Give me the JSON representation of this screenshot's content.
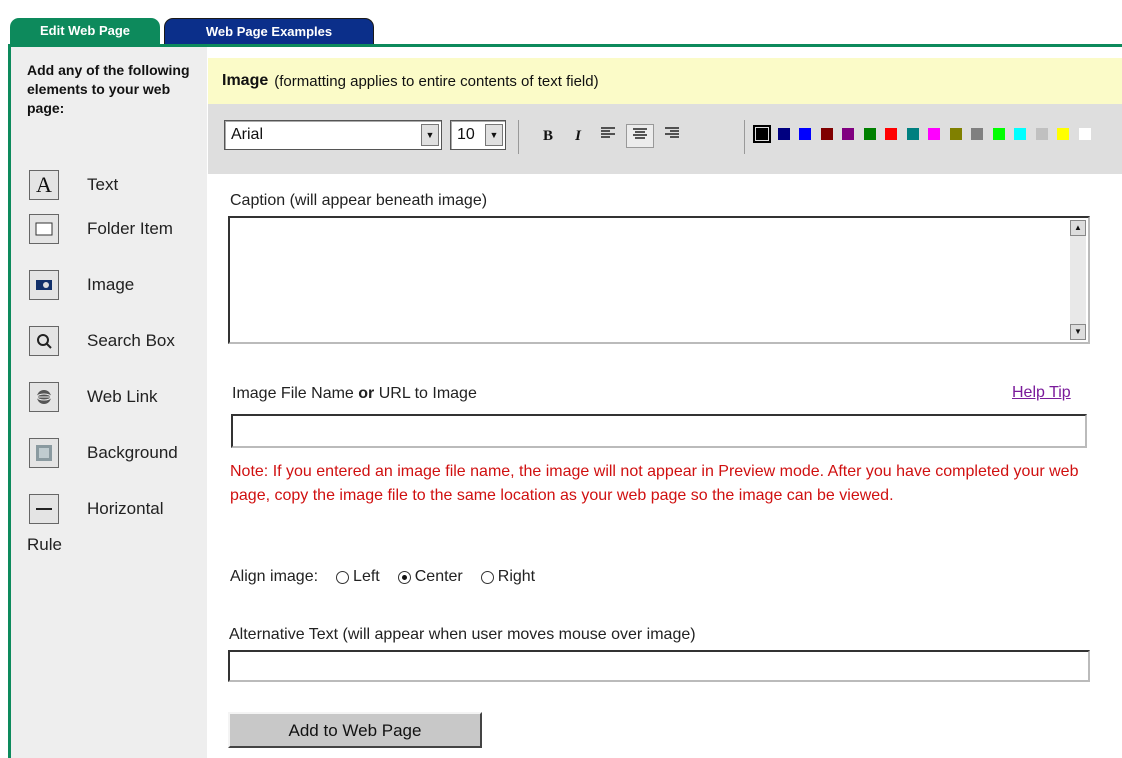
{
  "tabs": [
    {
      "label": "Edit Web Page",
      "active": true
    },
    {
      "label": "Web Page Examples",
      "active": false
    }
  ],
  "sidebar": {
    "heading": "Add any of the following elements to your web page:",
    "items": [
      {
        "label": "Text",
        "icon": "text-icon",
        "glyph": "A"
      },
      {
        "label": "Folder Item",
        "icon": "folder-item-icon",
        "glyph": "▭"
      },
      {
        "label": "Image",
        "icon": "image-icon",
        "glyph": "◘"
      },
      {
        "label": "Search Box",
        "icon": "search-icon",
        "glyph": "Q"
      },
      {
        "label": "Web Link",
        "icon": "web-link-icon",
        "glyph": "☗"
      },
      {
        "label": "Background",
        "icon": "background-icon",
        "glyph": "▣"
      },
      {
        "label": "Horizontal",
        "icon": "horizontal-rule-icon",
        "glyph": "—"
      }
    ],
    "rule_label": "Rule"
  },
  "banner": {
    "title": "Image",
    "subtitle": "(formatting applies to entire contents of text field)"
  },
  "toolbar": {
    "font": "Arial",
    "size": "10",
    "bold": "B",
    "italic": "I",
    "swatches": [
      "#000000",
      "#000080",
      "#0000ff",
      "#800000",
      "#800080",
      "#008000",
      "#ff0000",
      "#008080",
      "#ff00ff",
      "#808000",
      "#808080",
      "#00ff00",
      "#00ffff",
      "#c0c0c0",
      "#ffff00",
      "#ffffff"
    ]
  },
  "caption": {
    "label": "Caption (will appear beneath image)",
    "value": ""
  },
  "file": {
    "label_part1": "Image File Name",
    "label_or": "or",
    "label_part2": "URL to Image",
    "help": "Help Tip",
    "value": ""
  },
  "note": "Note: If you entered an image file name, the image will not appear in Preview mode. After you have completed your web page, copy the image file to the same location as your web page so the image can be viewed.",
  "align": {
    "label": "Align image:",
    "options": [
      "Left",
      "Center",
      "Right"
    ],
    "selected": "Center"
  },
  "alt_text": {
    "label": "Alternative Text (will appear when user moves mouse over image)",
    "value": ""
  },
  "submit_label": "Add to Web Page"
}
